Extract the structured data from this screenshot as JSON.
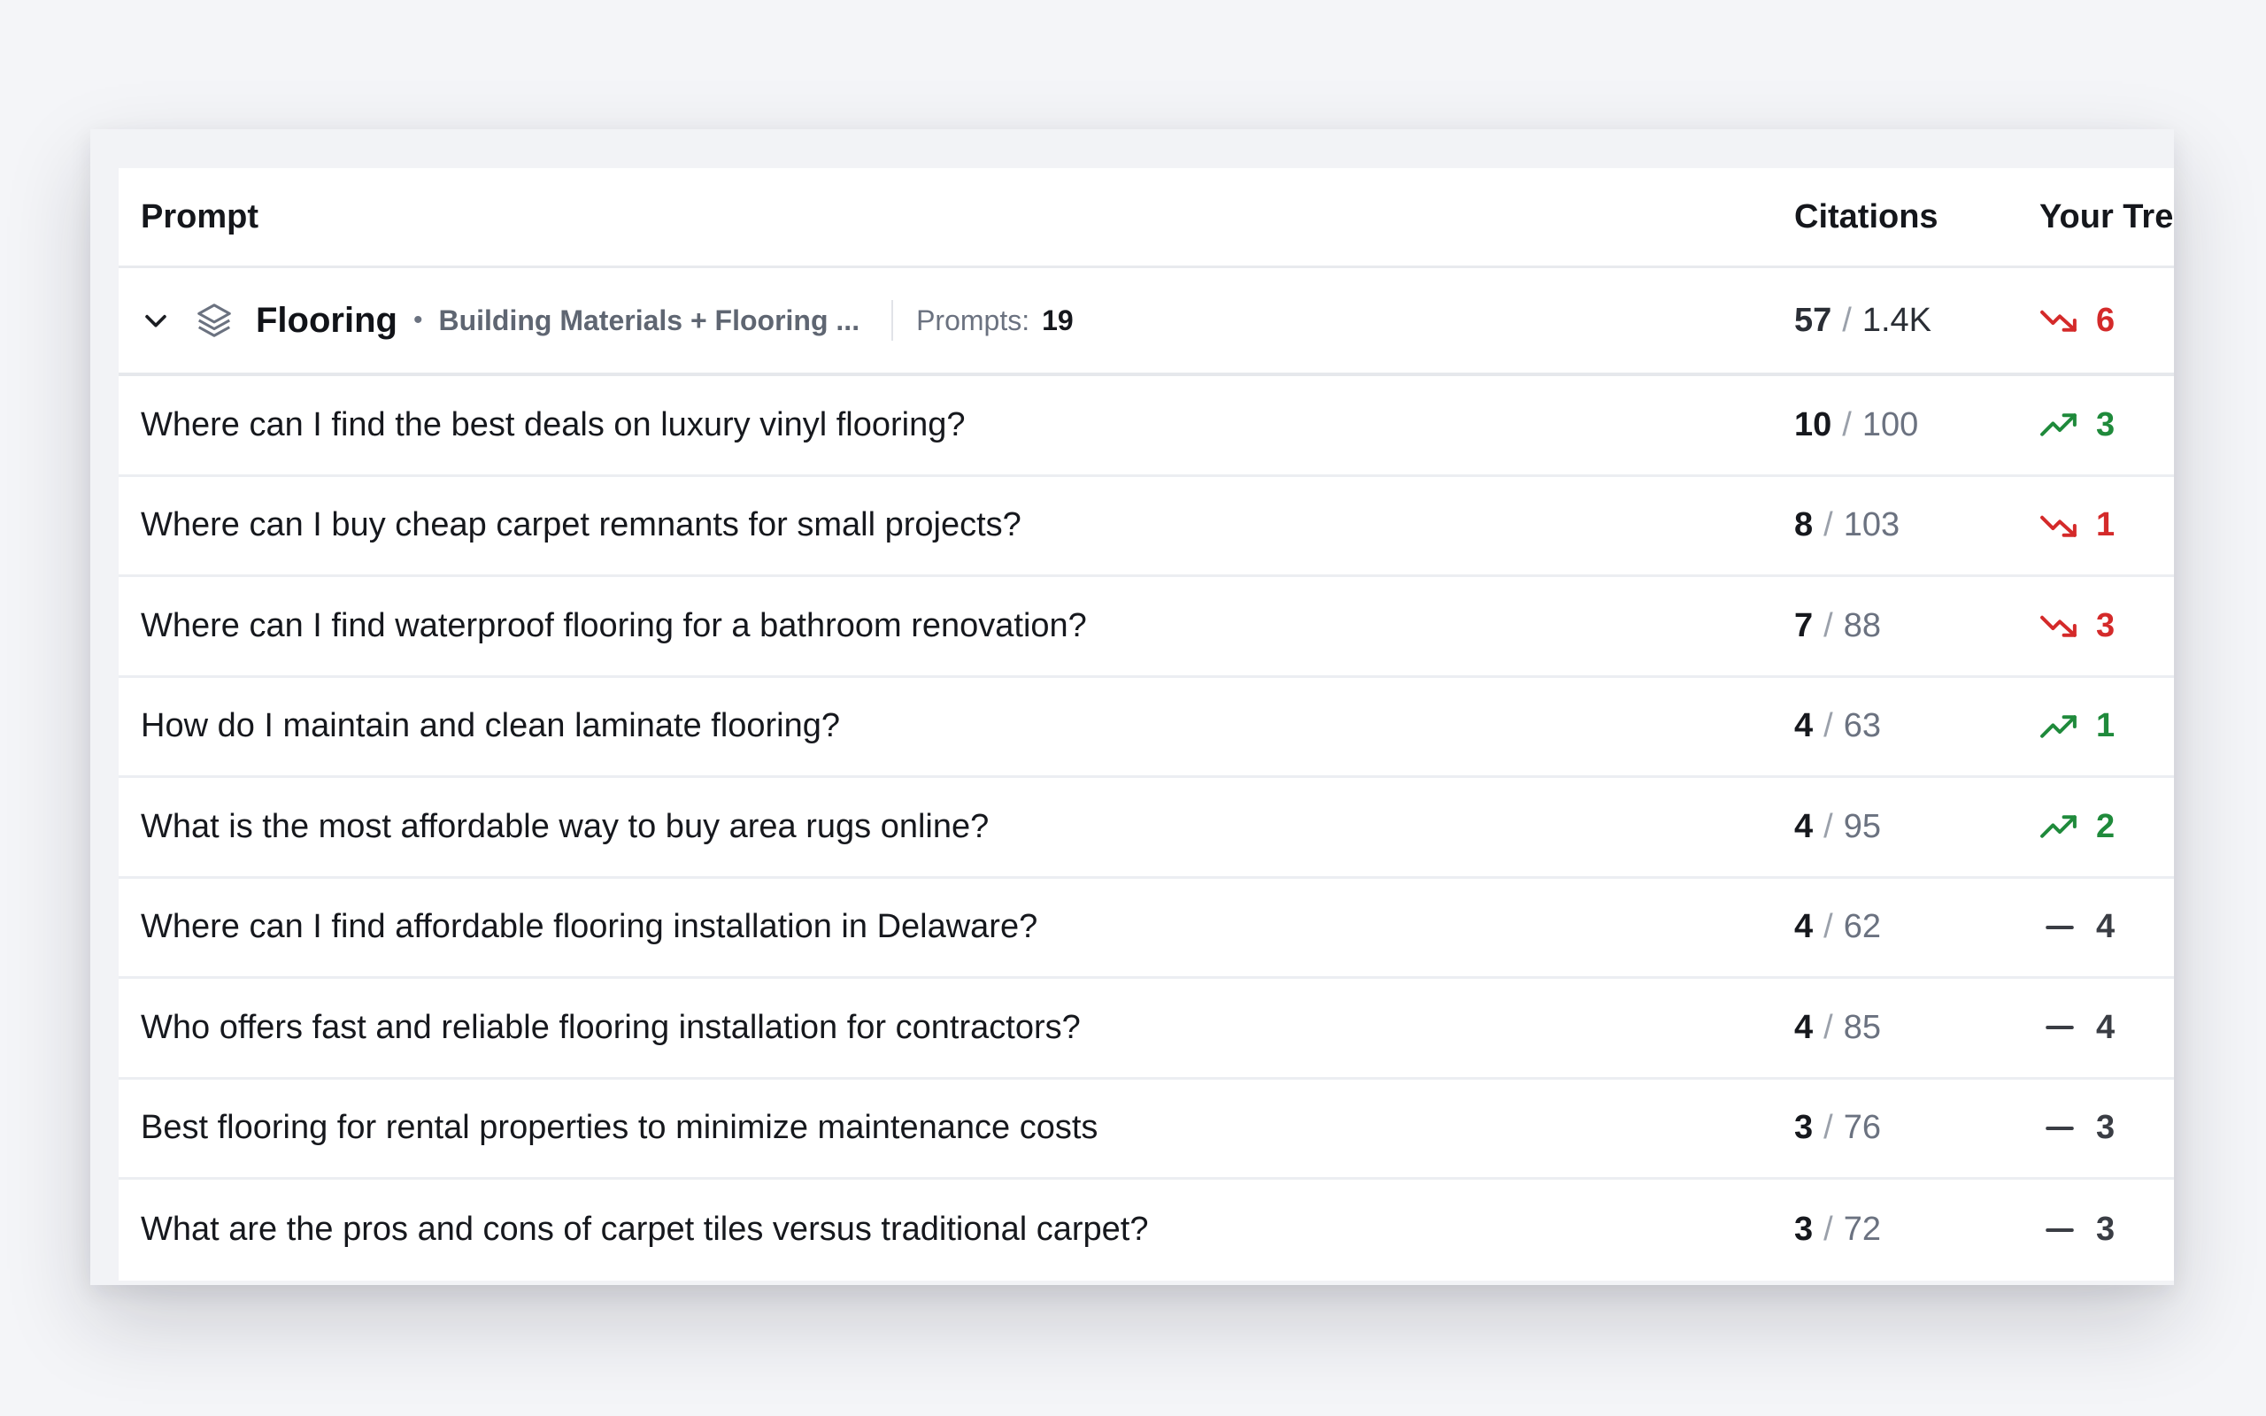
{
  "columns": {
    "prompt": "Prompt",
    "citations": "Citations",
    "trend": "Your Trend"
  },
  "group": {
    "name": "Flooring",
    "path": "Building Materials + Flooring ...",
    "prompts_label": "Prompts:",
    "prompts_count": "19",
    "citations": "57",
    "citations_total": "1.4K",
    "trend_direction": "down",
    "trend_value": "6"
  },
  "rows": [
    {
      "prompt": "Where can I find the best deals on luxury vinyl flooring?",
      "citations": "10",
      "total": "100",
      "trend_direction": "up",
      "trend_value": "3"
    },
    {
      "prompt": "Where can I buy cheap carpet remnants for small projects?",
      "citations": "8",
      "total": "103",
      "trend_direction": "down",
      "trend_value": "1"
    },
    {
      "prompt": "Where can I find waterproof flooring for a bathroom renovation?",
      "citations": "7",
      "total": "88",
      "trend_direction": "down",
      "trend_value": "3"
    },
    {
      "prompt": "How do I maintain and clean laminate flooring?",
      "citations": "4",
      "total": "63",
      "trend_direction": "up",
      "trend_value": "1"
    },
    {
      "prompt": "What is the most affordable way to buy area rugs online?",
      "citations": "4",
      "total": "95",
      "trend_direction": "up",
      "trend_value": "2"
    },
    {
      "prompt": "Where can I find affordable flooring installation in Delaware?",
      "citations": "4",
      "total": "62",
      "trend_direction": "flat",
      "trend_value": "4"
    },
    {
      "prompt": "Who offers fast and reliable flooring installation for contractors?",
      "citations": "4",
      "total": "85",
      "trend_direction": "flat",
      "trend_value": "4"
    },
    {
      "prompt": "Best flooring for rental properties to minimize maintenance costs",
      "citations": "3",
      "total": "76",
      "trend_direction": "flat",
      "trend_value": "3"
    },
    {
      "prompt": "What are the pros and cons of carpet tiles versus traditional carpet?",
      "citations": "3",
      "total": "72",
      "trend_direction": "flat",
      "trend_value": "3"
    }
  ],
  "colors": {
    "trend_up": "#1f8a3b",
    "trend_down": "#d42a2a",
    "trend_flat": "#3a3d44"
  },
  "icons": {
    "collapse": "chevron-down-icon",
    "group": "layers-icon",
    "trend_up": "trending-up-icon",
    "trend_down": "trending-down-icon",
    "trend_flat": "dash-icon"
  }
}
